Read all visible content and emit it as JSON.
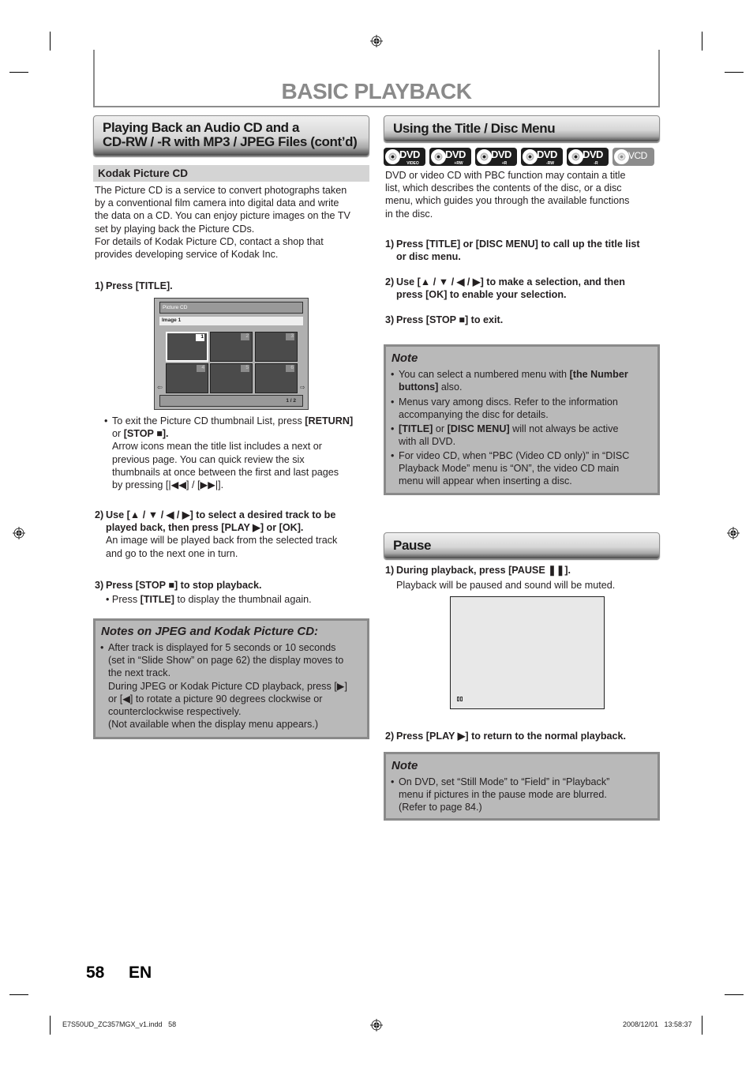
{
  "page": {
    "title": "BASIC PLAYBACK",
    "page_number": "58",
    "language": "EN",
    "slug_file": "E7S50UD_ZC357MGX_v1.indd   58",
    "slug_datetime": "2008/12/01   13:58:37"
  },
  "left": {
    "section_title_line1": "Playing Back an Audio CD and a",
    "section_title_line2": "CD-RW / -R with MP3 / JPEG Files (cont’d)",
    "subsection_title": "Kodak Picture CD",
    "intro": [
      "The Picture CD is a service to convert photographs taken",
      "by a conventional film camera into digital data and write",
      "the data on a CD. You can enjoy picture images on the TV",
      "set by playing back the Picture CDs.",
      "For details of Kodak Picture CD, contact a shop that",
      "provides developing service of Kodak Inc."
    ],
    "step1": {
      "num": "1)",
      "text": "Press [TITLE]."
    },
    "screen": {
      "header": "Picture CD",
      "image_label": "Image 1",
      "thumbnails": [
        "1",
        "2",
        "3",
        "4",
        "5",
        "6"
      ],
      "selected": "1",
      "page_indicator": "1 / 2",
      "left_arrow": "⇦",
      "right_arrow": "⇨"
    },
    "step1_bullet": {
      "pre": "To exit the Picture CD thumbnail List, press ",
      "return_key": "[RETURN]",
      "or": "or ",
      "stop_key": "[STOP ■].",
      "lines": [
        "Arrow icons mean the title list includes a next or",
        "previous page. You can quick review the six",
        "thumbnails at once between the first and last pages",
        "by pressing [|◀◀] / [▶▶|]."
      ]
    },
    "step2": {
      "num": "2)",
      "line1": "Use [▲ / ▼ / ◀ / ▶] to select a desired track to be",
      "line2": "played back, then press [PLAY ▶] or [OK].",
      "desc1": "An image will be played back from the selected track",
      "desc2": "and go to the next one in turn."
    },
    "step3": {
      "num": "3)",
      "text": "Press [STOP ■] to stop playback.",
      "bullet_pre": "Press ",
      "bullet_key": "[TITLE]",
      "bullet_post": " to display the thumbnail again."
    },
    "notes": {
      "title": "Notes on JPEG and Kodak Picture CD:",
      "lines": [
        "After track is displayed for 5 seconds or 10 seconds",
        "(set in “Slide Show” on page 62) the display moves to",
        "the next track.",
        "During JPEG or Kodak Picture CD playback, press [▶]",
        "or [◀] to rotate a picture 90 degrees clockwise or",
        "counterclockwise respectively.",
        "(Not available when the display menu appears.)"
      ]
    }
  },
  "right": {
    "section_title": "Using the Title / Disc Menu",
    "disc_icons": [
      {
        "name": "dvd-video",
        "label": "DVD",
        "sub": "VIDEO",
        "active": true
      },
      {
        "name": "dvd-plus-rw",
        "label": "DVD",
        "sub": "+RW",
        "active": true
      },
      {
        "name": "dvd-plus-r",
        "label": "DVD",
        "sub": "+R",
        "active": true
      },
      {
        "name": "dvd-minus-rw",
        "label": "DVD",
        "sub": "-RW",
        "active": true
      },
      {
        "name": "dvd-minus-r",
        "label": "DVD",
        "sub": "-R",
        "active": true
      },
      {
        "name": "vcd",
        "label": "VCD",
        "sub": "",
        "active": false
      }
    ],
    "intro": [
      "DVD or video CD with PBC function may contain a title",
      "list, which describes the contents of the disc, or a disc",
      "menu, which guides you through the available functions",
      "in the disc."
    ],
    "steps": [
      {
        "num": "1)",
        "line1": "Press [TITLE] or [DISC MENU] to call up the title list",
        "line2": "or disc menu."
      },
      {
        "num": "2)",
        "line1": "Use [▲ / ▼ / ◀ / ▶] to make a selection, and then",
        "line2": "press [OK] to enable your selection."
      },
      {
        "num": "3)",
        "line1": "Press [STOP ■] to exit.",
        "line2": ""
      }
    ],
    "note1": {
      "title": "Note",
      "b1_pre": "You can select a numbered menu with ",
      "b1_bold": "[the Number",
      "b1_bold2": "buttons]",
      "b1_post": " also.",
      "b2_l1": "Menus vary among discs. Refer to the information",
      "b2_l2": "accompanying the disc for details.",
      "b3_bold1": "[TITLE]",
      "b3_mid": " or ",
      "b3_bold2": "[DISC MENU]",
      "b3_post": " will not always be active",
      "b3_l2": "with all DVD.",
      "b4_l1": "For video CD, when “PBC (Video CD only)” in “DISC",
      "b4_l2": "Playback Mode” menu is “ON”, the video CD main",
      "b4_l3": "menu will appear when inserting a disc."
    },
    "pause": {
      "section_title": "Pause",
      "step1_num": "1)",
      "step1": "During playback, press [PAUSE ❚❚].",
      "step1_desc": "Playback will be paused and sound will be muted.",
      "step2_num": "2)",
      "step2": "Press [PLAY ▶] to return to the normal playback."
    },
    "note2": {
      "title": "Note",
      "l1": "On DVD, set “Still Mode” to “Field” in “Playback”",
      "l2": "menu if pictures in the pause mode are blurred.",
      "l3": "(Refer to page 84.)"
    }
  }
}
